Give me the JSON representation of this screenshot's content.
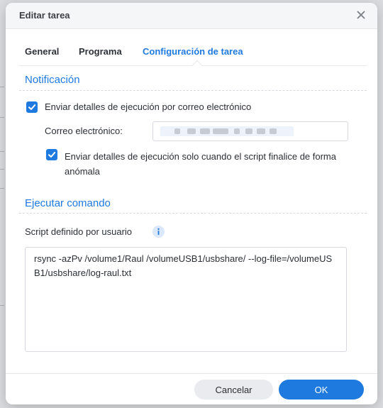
{
  "dialog": {
    "title": "Editar tarea",
    "close_icon": "close-icon"
  },
  "tabs": [
    {
      "label": "General",
      "active": false
    },
    {
      "label": "Programa",
      "active": false
    },
    {
      "label": "Configuración de tarea",
      "active": true
    }
  ],
  "notification": {
    "heading": "Notificación",
    "send_details_label": "Enviar detalles de ejecución por correo electrónico",
    "send_details_checked": true,
    "email_label": "Correo electrónico:",
    "email_value": "",
    "only_abnormal_label": "Enviar detalles de ejecución solo cuando el script finalice de forma anómala",
    "only_abnormal_checked": true
  },
  "run_command": {
    "heading": "Ejecutar comando",
    "script_label": "Script definido por usuario",
    "info_icon": "info-icon",
    "script_value": "rsync -azPv /volume1/Raul /volumeUSB1/usbshare/ --log-file=/volumeUSB1/usbshare/log-raul.txt"
  },
  "footer": {
    "cancel_label": "Cancelar",
    "ok_label": "OK"
  },
  "colors": {
    "accent": "#1f7ae0",
    "cancel_bg": "#e9ebee"
  }
}
